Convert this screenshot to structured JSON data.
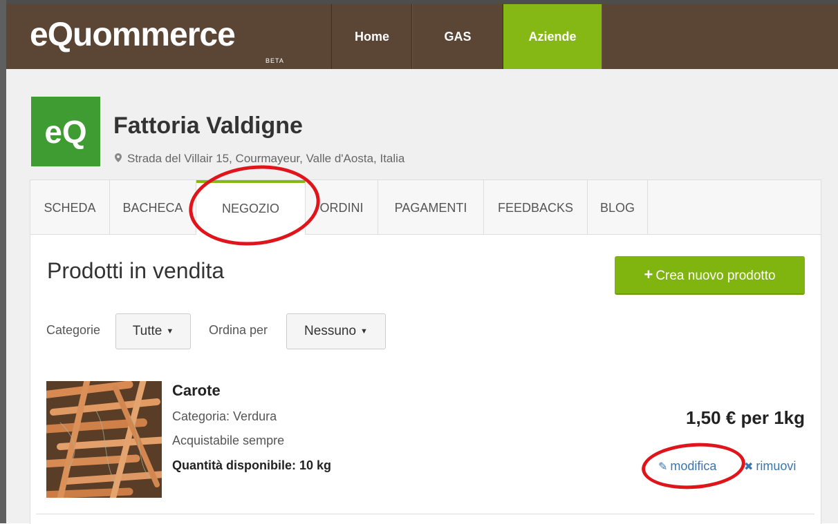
{
  "header": {
    "logo_text": "eQuommerce",
    "logo_badge": "BETA",
    "nav": [
      {
        "label": "Home"
      },
      {
        "label": "GAS"
      },
      {
        "label": "Aziende",
        "active": true
      }
    ]
  },
  "company": {
    "logo_text": "eQ",
    "name": "Fattoria Valdigne",
    "address": "Strada del Villair 15, Courmayeur, Valle d'Aosta, Italia"
  },
  "tabs": [
    {
      "label": "SCHEDA"
    },
    {
      "label": "BACHECA"
    },
    {
      "label": "NEGOZIO",
      "active": true
    },
    {
      "label": "ORDINI"
    },
    {
      "label": "PAGAMENTI"
    },
    {
      "label": "FEEDBACKS"
    },
    {
      "label": "BLOG"
    }
  ],
  "shop": {
    "title": "Prodotti in vendita",
    "create_button": "Crea nuovo prodotto",
    "filters": {
      "categories_label": "Categorie",
      "categories_value": "Tutte",
      "sort_label": "Ordina per",
      "sort_value": "Nessuno"
    },
    "product": {
      "name": "Carote",
      "category": "Categoria: Verdura",
      "availability": "Acquistabile sempre",
      "quantity": "Quantità disponibile: 10 kg",
      "price": "1,50 € per 1kg",
      "edit_label": "modifica",
      "remove_label": "rimuovi"
    }
  },
  "colors": {
    "header_bg": "#5b4636",
    "accent_green": "#85b814",
    "link_blue": "#3a75b0",
    "annotation_red": "#e0141b"
  }
}
